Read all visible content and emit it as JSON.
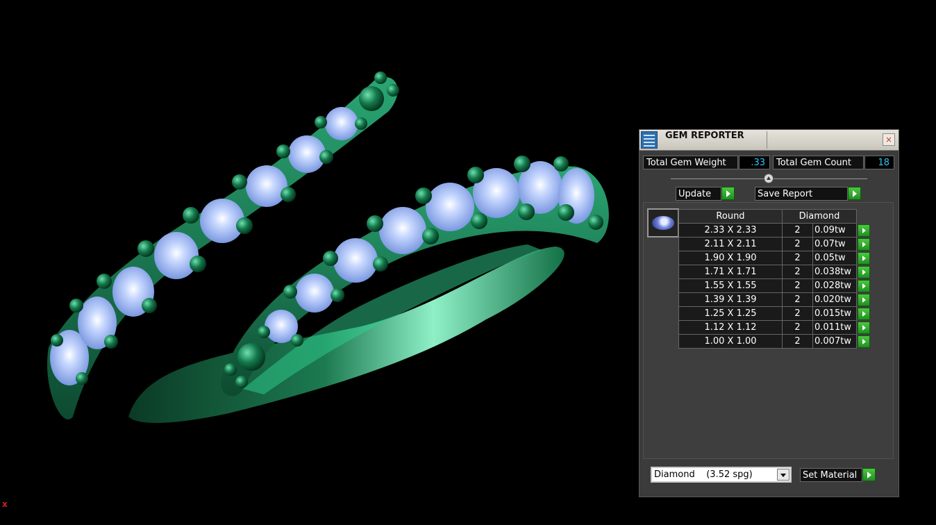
{
  "viewport": {
    "axis_indicator": "x",
    "colors": {
      "background": "#000000",
      "metal": "#1f8a5a",
      "stone": "#8fb0f0"
    }
  },
  "panel": {
    "title": "GEM REPORTER",
    "close_icon": "×",
    "total_weight_label": "Total Gem Weight",
    "total_weight_value": ".33",
    "total_count_label": "Total Gem Count",
    "total_count_value": "18",
    "update_label": "Update",
    "save_report_label": "Save Report",
    "table": {
      "shape_header": "Round",
      "type_header": "Diamond",
      "rows": [
        {
          "size": "2.33 X 2.33",
          "count": "2",
          "weight": "0.09tw"
        },
        {
          "size": "2.11 X 2.11",
          "count": "2",
          "weight": "0.07tw"
        },
        {
          "size": "1.90 X 1.90",
          "count": "2",
          "weight": "0.05tw"
        },
        {
          "size": "1.71 X 1.71",
          "count": "2",
          "weight": "0.038tw"
        },
        {
          "size": "1.55 X 1.55",
          "count": "2",
          "weight": "0.028tw"
        },
        {
          "size": "1.39 X 1.39",
          "count": "2",
          "weight": "0.020tw"
        },
        {
          "size": "1.25 X 1.25",
          "count": "2",
          "weight": "0.015tw"
        },
        {
          "size": "1.12 X 1.12",
          "count": "2",
          "weight": "0.011tw"
        },
        {
          "size": "1.00 X 1.00",
          "count": "2",
          "weight": "0.007tw"
        }
      ]
    },
    "material_value": "Diamond    (3.52 spg)",
    "set_material_label": "Set Material",
    "accent_green": "#2fa82f",
    "value_color": "#2ec7ff"
  }
}
